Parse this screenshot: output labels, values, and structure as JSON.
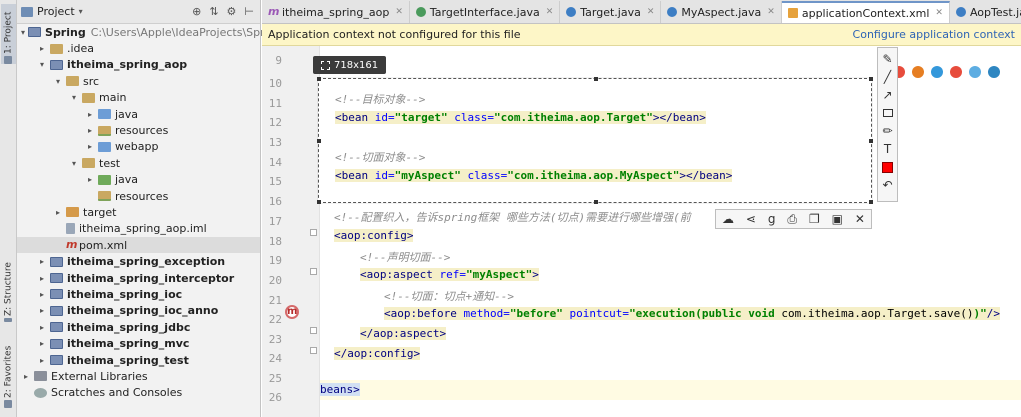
{
  "side_tabs": {
    "project": "1: Project",
    "structure": "Z: Structure",
    "favorites": "2: Favorites"
  },
  "project_panel": {
    "title": "Project",
    "icons": [
      "sync-icon",
      "collapse-icon",
      "settings-icon",
      "hide-icon"
    ],
    "tree": [
      {
        "label": "Spring",
        "path": "C:\\Users\\Apple\\IdeaProjects\\Spring",
        "bold": true,
        "indent": 0,
        "arrow": "▾",
        "icon": "module"
      },
      {
        "label": ".idea",
        "indent": 1,
        "arrow": "▸",
        "icon": "folder"
      },
      {
        "label": "itheima_spring_aop",
        "bold": true,
        "indent": 1,
        "arrow": "▾",
        "icon": "module"
      },
      {
        "label": "src",
        "indent": 2,
        "arrow": "▾",
        "icon": "folder"
      },
      {
        "label": "main",
        "indent": 3,
        "arrow": "▾",
        "icon": "folder"
      },
      {
        "label": "java",
        "indent": 4,
        "arrow": "▸",
        "icon": "folder-blue"
      },
      {
        "label": "resources",
        "indent": 4,
        "arrow": "▸",
        "icon": "folder-res"
      },
      {
        "label": "webapp",
        "indent": 4,
        "arrow": "▸",
        "icon": "folder-blue"
      },
      {
        "label": "test",
        "indent": 3,
        "arrow": "▾",
        "icon": "folder"
      },
      {
        "label": "java",
        "indent": 4,
        "arrow": "▸",
        "icon": "folder-green"
      },
      {
        "label": "resources",
        "indent": 4,
        "arrow": "",
        "icon": "folder-res"
      },
      {
        "label": "target",
        "indent": 2,
        "arrow": "▸",
        "icon": "folder-orange"
      },
      {
        "label": "itheima_spring_aop.iml",
        "indent": 2,
        "arrow": "",
        "icon": "file-iml"
      },
      {
        "label": "pom.xml",
        "indent": 2,
        "arrow": "",
        "icon": "file-m",
        "selected": true
      },
      {
        "label": "itheima_spring_exception",
        "bold": true,
        "indent": 1,
        "arrow": "▸",
        "icon": "module"
      },
      {
        "label": "itheima_spring_interceptor",
        "bold": true,
        "indent": 1,
        "arrow": "▸",
        "icon": "module"
      },
      {
        "label": "itheima_spring_ioc",
        "bold": true,
        "indent": 1,
        "arrow": "▸",
        "icon": "module"
      },
      {
        "label": "itheima_spring_ioc_anno",
        "bold": true,
        "indent": 1,
        "arrow": "▸",
        "icon": "module"
      },
      {
        "label": "itheima_spring_jdbc",
        "bold": true,
        "indent": 1,
        "arrow": "▸",
        "icon": "module"
      },
      {
        "label": "itheima_spring_mvc",
        "bold": true,
        "indent": 1,
        "arrow": "▸",
        "icon": "module"
      },
      {
        "label": "itheima_spring_test",
        "bold": true,
        "indent": 1,
        "arrow": "▸",
        "icon": "module"
      },
      {
        "label": "External Libraries",
        "indent": 0,
        "arrow": "▸",
        "icon": "lib"
      },
      {
        "label": "Scratches and Consoles",
        "indent": 0,
        "arrow": "",
        "icon": "scratch"
      }
    ]
  },
  "tabs": [
    {
      "label": "itheima_spring_aop",
      "icon": "m",
      "active": false
    },
    {
      "label": "TargetInterface.java",
      "icon": "i",
      "active": false
    },
    {
      "label": "Target.java",
      "icon": "c",
      "active": false
    },
    {
      "label": "MyAspect.java",
      "icon": "c",
      "active": false
    },
    {
      "label": "applicationContext.xml",
      "icon": "xml",
      "active": true
    },
    {
      "label": "AopTest.java",
      "icon": "c",
      "active": false
    }
  ],
  "notification": {
    "message": "Application context not configured for this file",
    "action": "Configure application context"
  },
  "editor": {
    "line_numbers": [
      "9",
      "10",
      "11",
      "12",
      "13",
      "14",
      "15",
      "16",
      "17",
      "18",
      "19",
      "20",
      "21",
      "22",
      "23",
      "24",
      "25",
      "26"
    ],
    "lines": {
      "comment_target": "<!--目标对象-->",
      "bean_target_open": "<bean ",
      "bean_target_id_attr": "id=",
      "bean_target_id_val": "\"target\"",
      "bean_target_class_attr": " class=",
      "bean_target_class_val": "\"com.itheima.aop.Target\"",
      "bean_target_close": "></bean>",
      "comment_aspect": "<!--切面对象-->",
      "bean_aspect_open": "<bean ",
      "bean_aspect_id_attr": "id=",
      "bean_aspect_id_val": "\"myAspect\"",
      "bean_aspect_class_attr": " class=",
      "bean_aspect_class_val": "\"com.itheima.aop.MyAspect\"",
      "bean_aspect_close": "></bean>",
      "comment_weave": "<!--配置织入，告诉spring框架 哪些方法(切点)需要进行哪些增强(前",
      "aop_config_open": "<aop:config>",
      "comment_declare": "<!--声明切面-->",
      "aspect_open_tag": "<aop:aspect ",
      "aspect_ref_attr": "ref=",
      "aspect_ref_val": "\"myAspect\"",
      "aspect_open_end": ">",
      "comment_pointcut": "<!--切面：切点+通知-->",
      "before_tag": "<aop:before ",
      "before_method_attr": "method=",
      "before_method_val": "\"before\"",
      "before_pointcut_attr": " pointcut=",
      "before_pointcut_val_a": "\"execution(",
      "before_pointcut_val_b": "public void ",
      "before_pointcut_val_c": "com.itheima.aop.Target.save()",
      "before_pointcut_val_d": ")\"",
      "before_end": "/>",
      "aspect_close": "</aop:aspect>",
      "aop_config_close": "</aop:config>",
      "beans_close": "beans>"
    }
  },
  "capture": {
    "size_label": "718x161"
  },
  "draw_tools": [
    "pencil-icon",
    "line-icon",
    "arrow-icon",
    "rectangle-icon",
    "marker-icon",
    "text-icon",
    "color-swatch",
    "undo-icon"
  ],
  "draw_color": "#ff0000",
  "action_bar": [
    "cloud-upload-icon",
    "share-icon",
    "search-engine-icon",
    "print-icon",
    "copy-icon",
    "save-icon",
    "close-icon"
  ],
  "accent": "#6f95c8"
}
